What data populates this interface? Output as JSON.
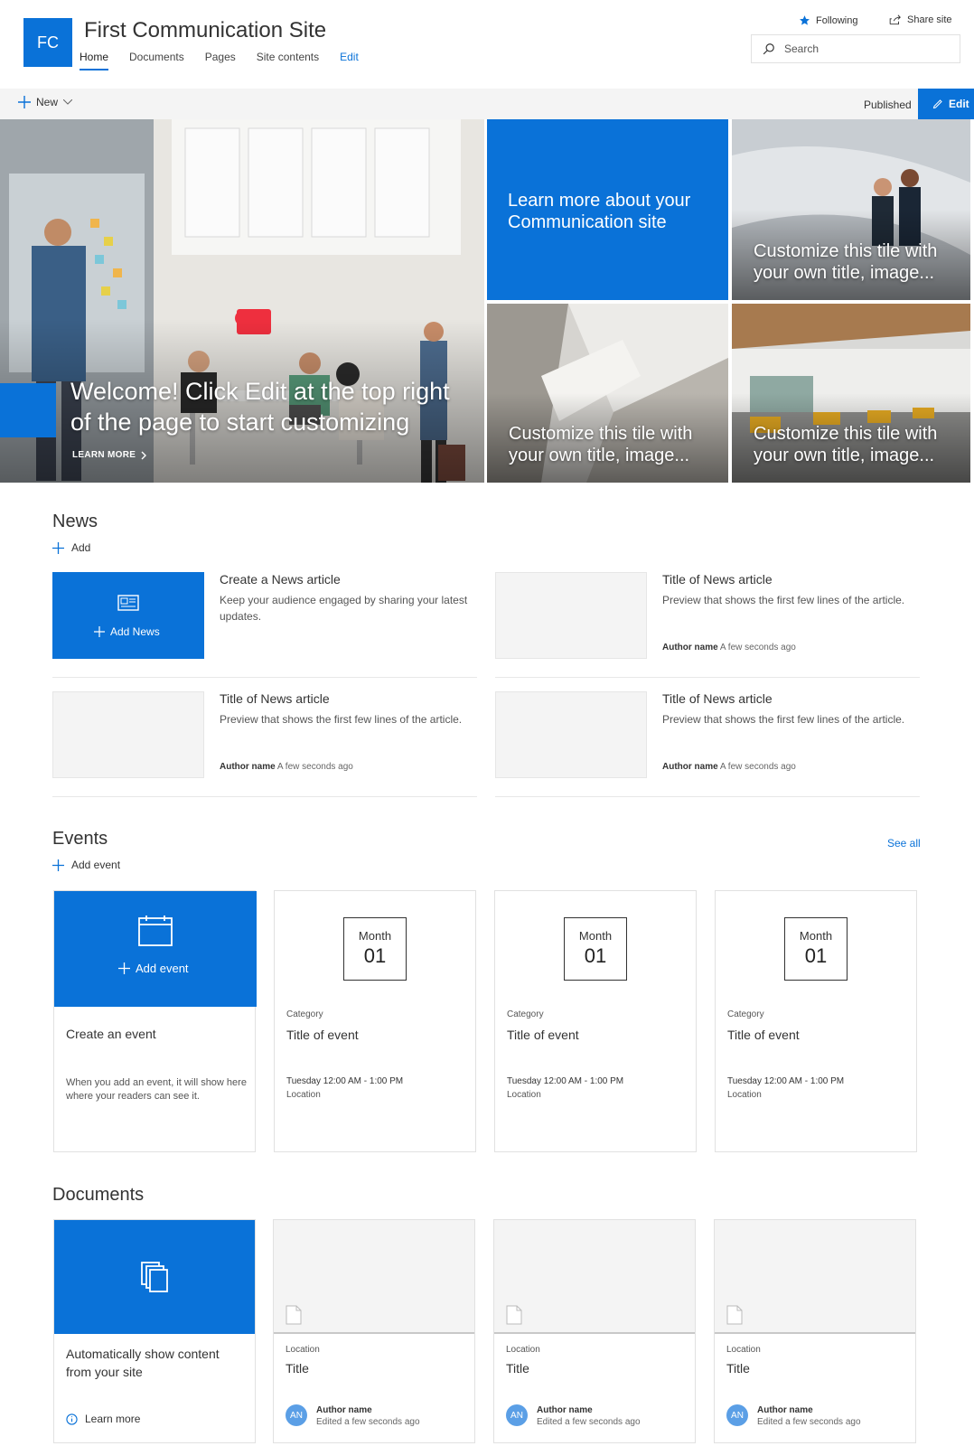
{
  "header": {
    "logo_text": "FC",
    "site_title": "First Communication Site",
    "nav": [
      "Home",
      "Documents",
      "Pages",
      "Site contents",
      "Edit"
    ],
    "following_label": "Following",
    "share_label": "Share site",
    "search_placeholder": "Search"
  },
  "command_bar": {
    "new_label": "New",
    "status": "Published",
    "edit_label": "Edit"
  },
  "hero": {
    "main_title": "Welcome! Click Edit at the top right of the page to start customizing",
    "main_link": "LEARN MORE",
    "tile_learn": "Learn more about your Communication site",
    "tile_1": "Customize this tile with your own title, image...",
    "tile_2": "Customize this tile with your own title, image...",
    "tile_3": "Customize this tile with your own title, image..."
  },
  "news": {
    "heading": "News",
    "add_label": "Add",
    "add_news_label": "Add News",
    "create_title": "Create a News article",
    "create_desc": "Keep your audience engaged by sharing your latest updates.",
    "articles": [
      {
        "title": "Title of News article",
        "preview": "Preview that shows the first few lines of the article.",
        "author": "Author name",
        "time": "A few seconds ago"
      },
      {
        "title": "Title of News article",
        "preview": "Preview that shows the first few lines of the article.",
        "author": "Author name",
        "time": "A few seconds ago"
      },
      {
        "title": "Title of News article",
        "preview": "Preview that shows the first few lines of the article.",
        "author": "Author name",
        "time": "A few seconds ago"
      }
    ]
  },
  "events": {
    "heading": "Events",
    "see_all": "See all",
    "add_label": "Add event",
    "add_card_label": "Add event",
    "create_title": "Create an event",
    "create_desc": "When you add an event, it will show here where your readers can see it.",
    "items": [
      {
        "month": "Month",
        "day": "01",
        "category": "Category",
        "title": "Title of event",
        "when": "Tuesday 12:00 AM - 1:00 PM",
        "location": "Location"
      },
      {
        "month": "Month",
        "day": "01",
        "category": "Category",
        "title": "Title of event",
        "when": "Tuesday 12:00 AM - 1:00 PM",
        "location": "Location"
      },
      {
        "month": "Month",
        "day": "01",
        "category": "Category",
        "title": "Title of event",
        "when": "Tuesday 12:00 AM - 1:00 PM",
        "location": "Location"
      }
    ]
  },
  "documents": {
    "heading": "Documents",
    "auto_title": "Automatically show content from your site",
    "learn_more": "Learn more",
    "items": [
      {
        "location": "Location",
        "title": "Title",
        "initials": "AN",
        "author": "Author name",
        "edited": "Edited a few seconds ago"
      },
      {
        "location": "Location",
        "title": "Title",
        "initials": "AN",
        "author": "Author name",
        "edited": "Edited a few seconds ago"
      },
      {
        "location": "Location",
        "title": "Title",
        "initials": "AN",
        "author": "Author name",
        "edited": "Edited a few seconds ago"
      }
    ]
  },
  "colors": {
    "accent": "#0a72d8",
    "surface": "#f4f4f4"
  }
}
